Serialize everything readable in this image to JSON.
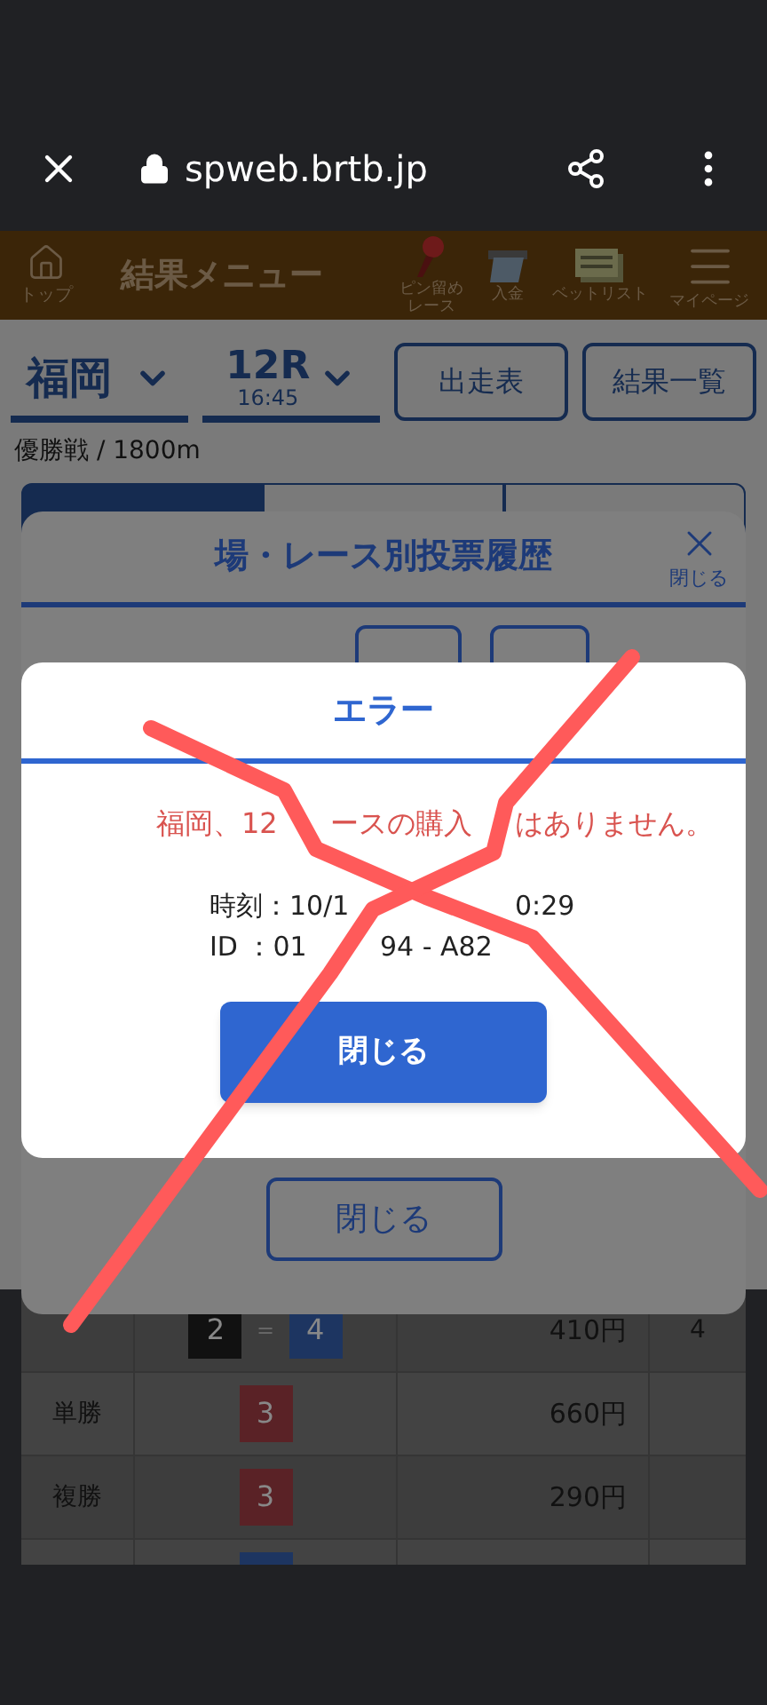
{
  "browser": {
    "url": "spweb.brtb.jp"
  },
  "header": {
    "home_label": "トップ",
    "title": "結果メニュー",
    "nav": [
      {
        "kind": "pin",
        "label": [
          "ピン留め",
          "レース"
        ]
      },
      {
        "kind": "deposit",
        "label": "入金"
      },
      {
        "kind": "betlist",
        "label": "ベットリスト"
      },
      {
        "kind": "menu",
        "label": "マイページ"
      }
    ]
  },
  "selectors": {
    "venue": "福岡",
    "race": "12R",
    "time": "16:45",
    "buttons": [
      "出走表",
      "結果一覧"
    ]
  },
  "race_info": "優勝戦 / 1800m",
  "tabs": [
    {
      "selected": true
    },
    {
      "selected": false
    },
    {
      "selected": false
    }
  ],
  "history_modal": {
    "title": "場・レース別投票履歴",
    "close_label": "閉じる",
    "button": "閉じる"
  },
  "error_dialog": {
    "title": "エラー",
    "message_parts": [
      "福岡、12",
      "ースの購入",
      "はありません。"
    ],
    "lines": [
      [
        "時刻：10/1",
        "0:29"
      ],
      [
        "ID ：01",
        "94 - A82"
      ]
    ],
    "button": "閉じる"
  },
  "table": {
    "rows": [
      {
        "type": "",
        "badges": [
          {
            "number": "2",
            "color": "#111111"
          },
          {
            "joiner": "=",
            "number": "4",
            "color": "#1d3561"
          }
        ],
        "payout": "410円",
        "popularity": "4"
      },
      {
        "type": "単勝",
        "badges": [
          {
            "number": "3",
            "color": "#5a2226"
          }
        ],
        "payout": "660円"
      },
      {
        "type": "複勝",
        "badges": [
          {
            "number": "3",
            "color": "#5a2226"
          }
        ],
        "payout": "290円"
      },
      {
        "badges": [
          {
            "color": "#1d3561"
          }
        ]
      }
    ]
  }
}
